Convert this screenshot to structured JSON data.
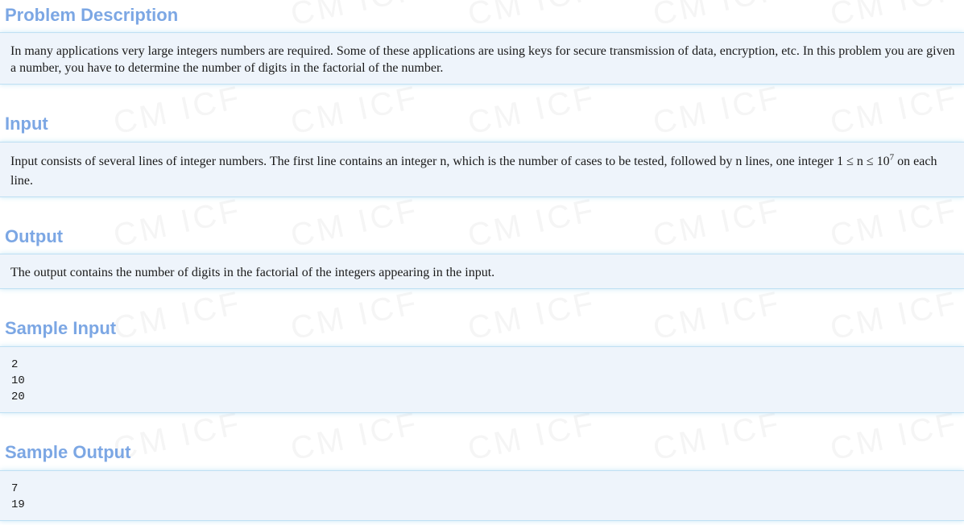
{
  "sections": {
    "description": {
      "heading": "Problem Description",
      "text": "In many applications very large integers numbers are required. Some of these applications are using keys for secure transmission of data, encryption, etc. In this problem you are given a number, you have to determine the number of digits in the factorial of the number."
    },
    "input": {
      "heading": "Input",
      "text_part1": "Input consists of several lines of integer numbers. The first line contains an integer n, which is the number of cases to be tested, followed by n lines, one integer 1 ≤ n ≤ 10",
      "exponent": "7",
      "text_part2": " on each line."
    },
    "output": {
      "heading": "Output",
      "text": "The output contains the number of digits in the factorial of the integers appearing in the input."
    },
    "sample_input": {
      "heading": "Sample Input",
      "lines": [
        "2",
        "10",
        "20"
      ]
    },
    "sample_output": {
      "heading": "Sample Output",
      "lines": [
        "7",
        "19"
      ]
    }
  },
  "watermark": "CM ICF",
  "colors": {
    "heading": "#7ca7e4",
    "panel_bg": "#eef4fb",
    "panel_border": "#bfe0f3"
  }
}
